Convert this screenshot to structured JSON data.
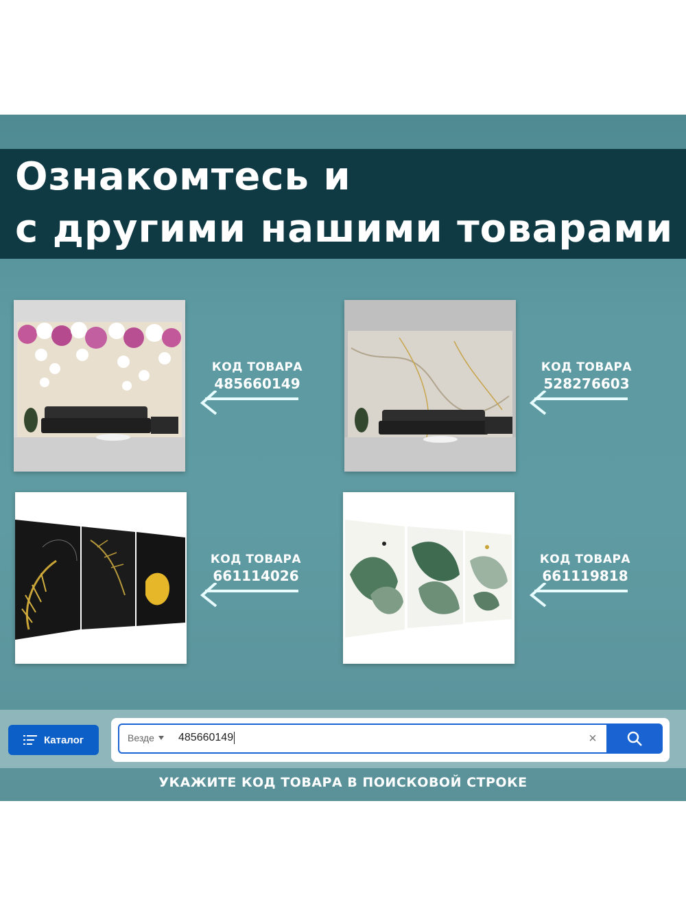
{
  "title": {
    "line1": "Ознакомтесь и",
    "line2": "с другими нашими товарами"
  },
  "products": [
    {
      "code_label": "КОД ТОВАРА",
      "code": "485660149",
      "image": "orchid-wall-mural"
    },
    {
      "code_label": "КОД ТОВАРА",
      "code": "528276603",
      "image": "marble-wall-mural"
    },
    {
      "code_label": "КОД ТОВАРА",
      "code": "661114026",
      "image": "gold-leaves-triptych"
    },
    {
      "code_label": "КОД ТОВАРА",
      "code": "661119818",
      "image": "monstera-triptych"
    }
  ],
  "search": {
    "catalog_label": "Каталог",
    "scope": "Везде",
    "query": "485660149"
  },
  "hint": "УКАЖИТЕ КОД ТОВАРА В ПОИСКОВОЙ СТРОКЕ",
  "colors": {
    "title_band": "#0f3a44",
    "panel": "#5d9aa1",
    "accent_blue": "#1a63d3",
    "arrow_glow": "#c8fbff"
  },
  "icons": [
    "arrow-left-icon",
    "menu-icon",
    "chevron-down-icon",
    "close-icon",
    "search-icon"
  ]
}
